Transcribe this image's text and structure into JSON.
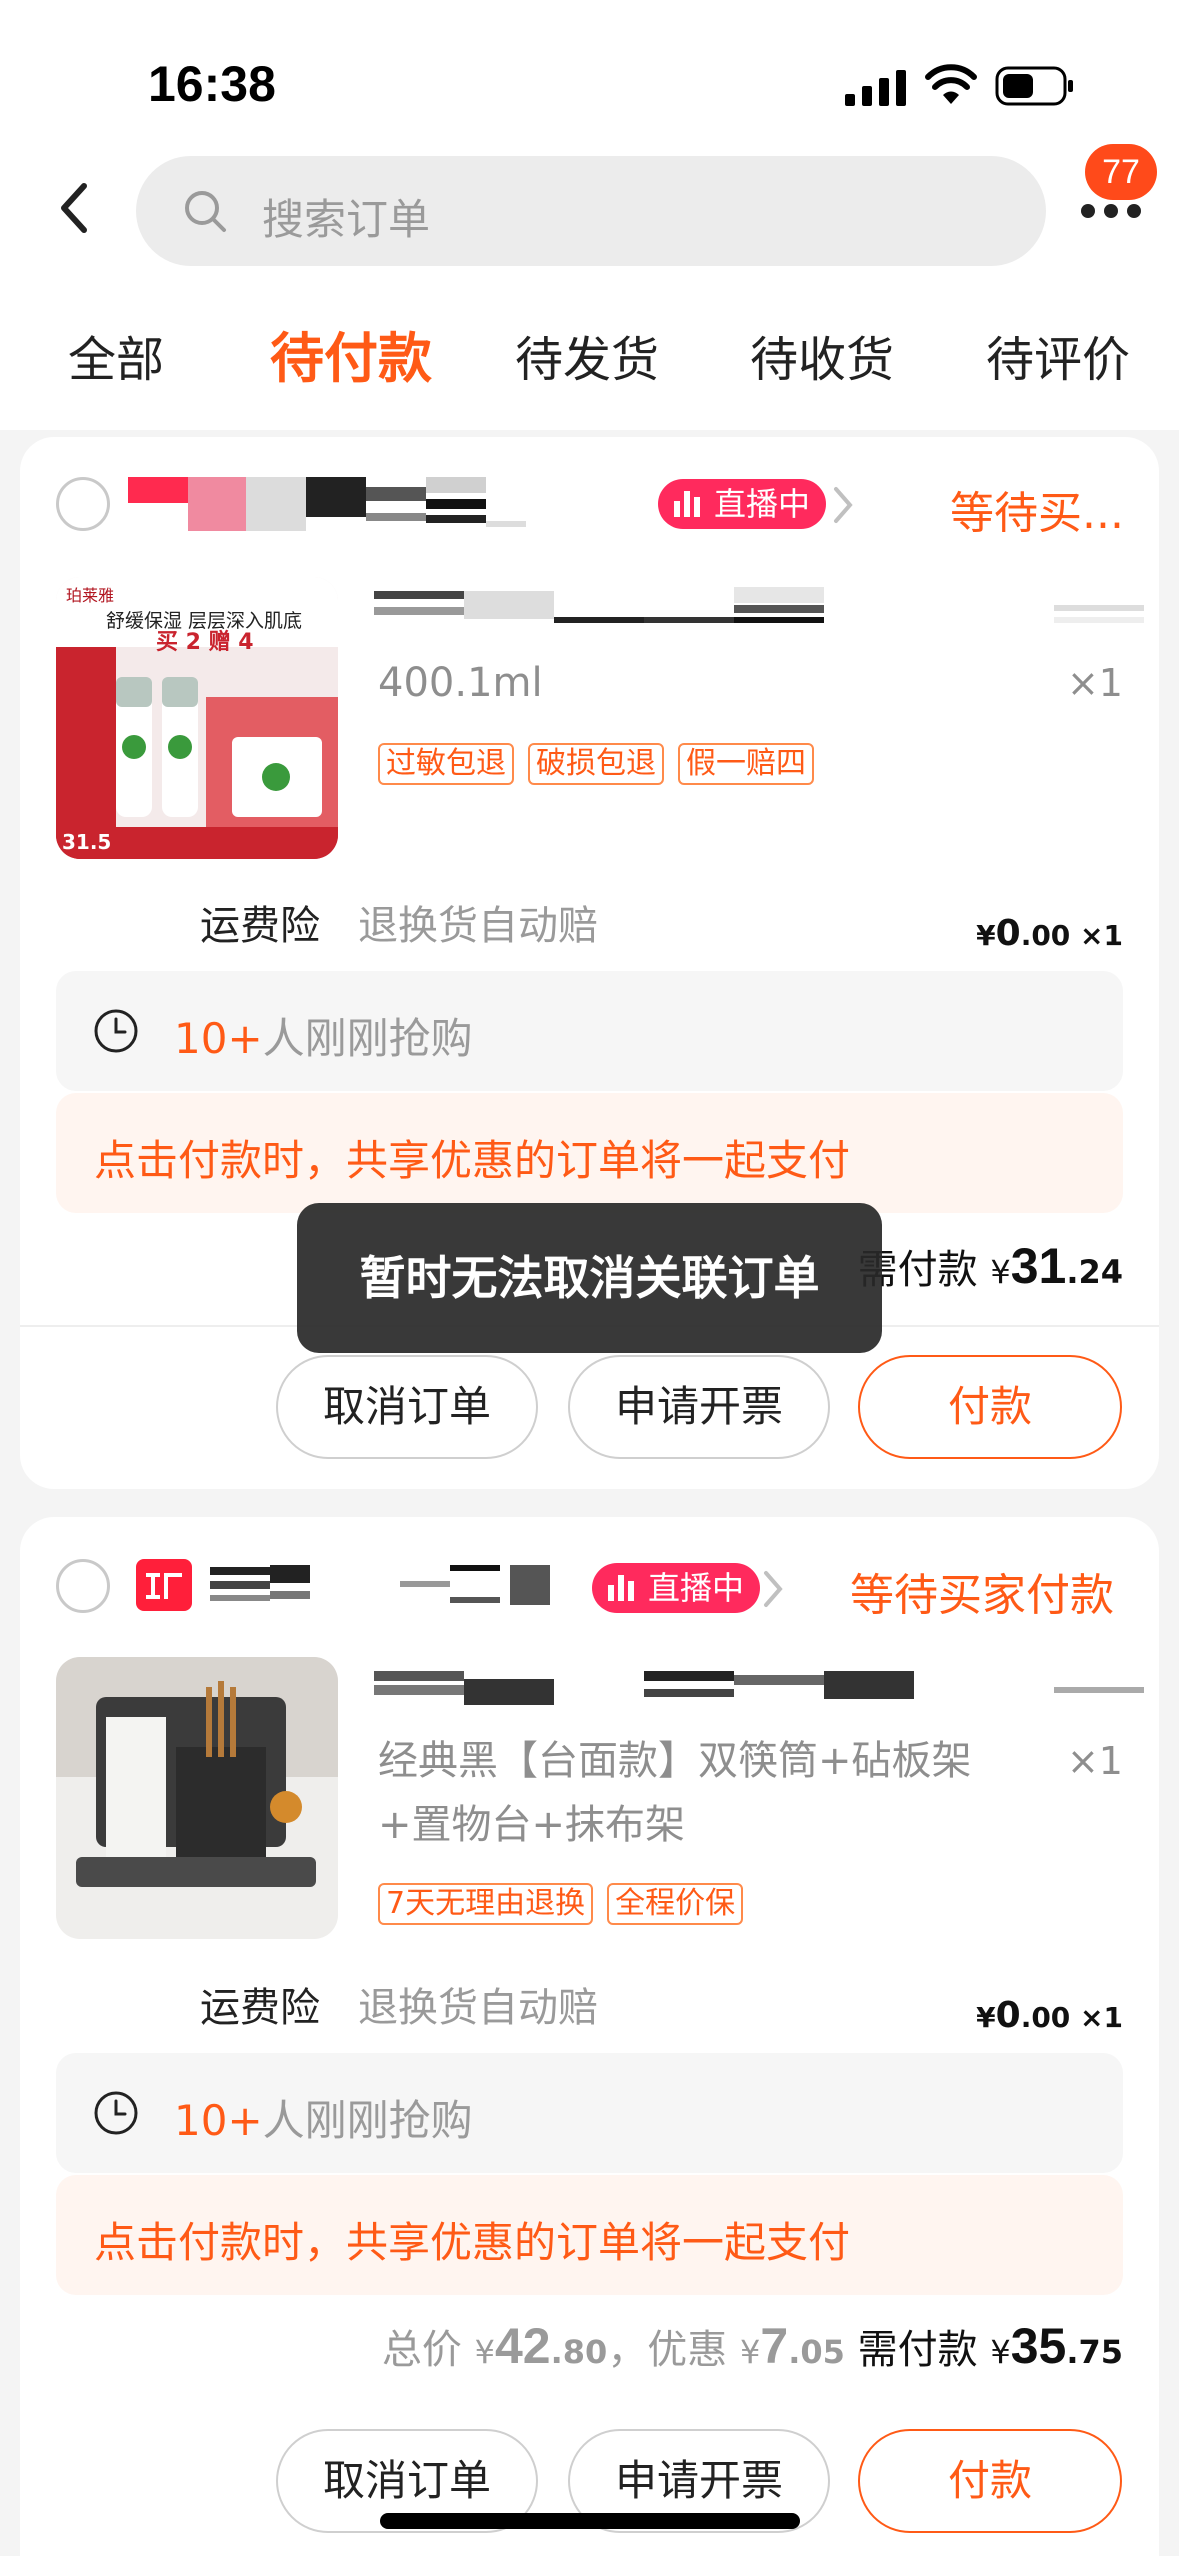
{
  "status_bar": {
    "time": "16:38"
  },
  "header": {
    "search_placeholder": "搜索订单",
    "badge_count": "77"
  },
  "tabs": [
    {
      "label": "全部"
    },
    {
      "label": "待付款",
      "active": true
    },
    {
      "label": "待发货"
    },
    {
      "label": "待收货"
    },
    {
      "label": "待评价"
    }
  ],
  "orders": [
    {
      "live_label": "直播中",
      "status": "等待买...",
      "sku": "400.1ml",
      "qty": "×1",
      "tags": [
        "过敏包退",
        "破损包退",
        "假一赔四"
      ],
      "thumb_text": {
        "brand": "珀莱雅",
        "line1": "舒缓保湿 层层深入肌底",
        "line2": "买 2 赠 4",
        "price": "31.5"
      },
      "insurance_label": "运费险",
      "insurance_desc": "退换货自动赔",
      "insurance_currency": "¥",
      "insurance_int": "0",
      "insurance_frac": ".00",
      "insurance_qty": "×1",
      "hot_num": "10+",
      "hot_text": "人刚刚抢购",
      "share_text": "点击付款时，共享优惠的订单将一起支付",
      "pay_label": "需付款",
      "pay_currency": "¥",
      "pay_int": "31",
      "pay_frac": ".24",
      "buttons": {
        "cancel": "取消订单",
        "invoice": "申请开票",
        "pay": "付款"
      }
    },
    {
      "live_label": "直播中",
      "status": "等待买家付款",
      "sku": "经典黑【台面款】双筷筒+砧板架+置物台+抹布架",
      "qty": "×1",
      "tags": [
        "7天无理由退换",
        "全程价保"
      ],
      "insurance_label": "运费险",
      "insurance_desc": "退换货自动赔",
      "insurance_currency": "¥",
      "insurance_int": "0",
      "insurance_frac": ".00",
      "insurance_qty": "×1",
      "hot_num": "10+",
      "hot_text": "人刚刚抢购",
      "share_text": "点击付款时，共享优惠的订单将一起支付",
      "total_label": "总价",
      "total_currency": "¥",
      "total_int": "42",
      "total_frac": ".80",
      "discount_label": "，优惠",
      "discount_currency": "¥",
      "discount_int": "7",
      "discount_frac": ".05",
      "pay_label": "需付款",
      "pay_currency": "¥",
      "pay_int": "35",
      "pay_frac": ".75",
      "buttons": {
        "cancel": "取消订单",
        "invoice": "申请开票",
        "pay": "付款"
      }
    }
  ],
  "toast": "暂时无法取消关联订单",
  "colors": {
    "accent": "#ff5a16",
    "live": "#ff2a5d",
    "badge": "#ff4a1a"
  }
}
